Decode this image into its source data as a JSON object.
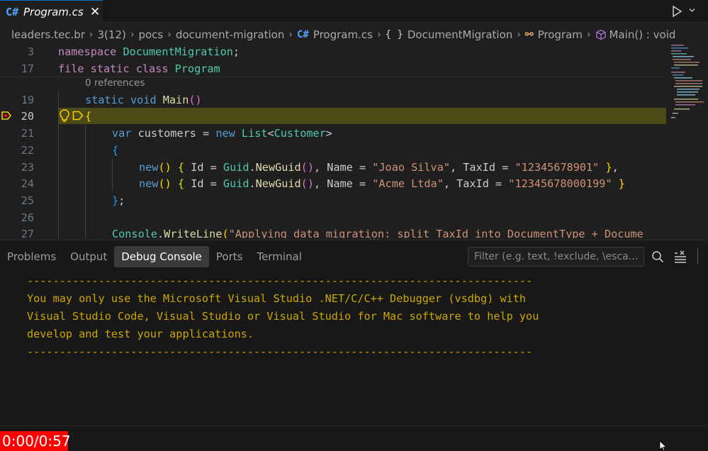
{
  "tab": {
    "icon": "csharp-file-icon",
    "glyph": "C#",
    "title": "Program.cs",
    "close": "✕"
  },
  "breadcrumb": {
    "items": [
      {
        "label": "leaders.tec.br"
      },
      {
        "label": "3(12)"
      },
      {
        "label": "pocs"
      },
      {
        "label": "document-migration"
      },
      {
        "label": "Program.cs",
        "icon": "csharp-file-icon",
        "glyph": "C#"
      },
      {
        "label": "DocumentMigration",
        "icon": "namespace-braces-icon",
        "glyph": "{ }"
      },
      {
        "label": "Program",
        "icon": "class-icon",
        "glyph": "⚯"
      },
      {
        "label": "Main() : void",
        "icon": "method-cube-icon"
      }
    ],
    "separator": "›"
  },
  "editor": {
    "codelens": "0 references",
    "current_line": "20",
    "line_numbers": [
      "3",
      "17",
      "19",
      "20",
      "21",
      "22",
      "23",
      "24",
      "25",
      "26",
      "27"
    ],
    "lines": {
      "l3": {
        "kw": "namespace",
        "ns": "DocumentMigration",
        "end": ";"
      },
      "l17": {
        "kw1": "file",
        "kw2": "static",
        "kw3": "class",
        "ty": "Program"
      },
      "l19": {
        "kw1": "static",
        "kw2": "void",
        "fn": "Main",
        "p1": "(",
        "p2": ")"
      },
      "l20": {
        "brace": "{"
      },
      "l21": {
        "kw": "var",
        "id": " customers = ",
        "kwnew": "new",
        "ty": "List",
        "lt": "<",
        "ty2": "Customer",
        "gt": ">"
      },
      "l22": {
        "brace": "{"
      },
      "l23": {
        "new": "new",
        "p": "()",
        "ob": "{",
        "a": " Id = ",
        "guid": "Guid",
        "dot": ".",
        "fn": "NewGuid",
        "p2": "()",
        "b": ", Name = ",
        "s1": "\"Joao Silva\"",
        "c": ", TaxId = ",
        "s2": "\"12345678901\"",
        "cb": "}",
        "end": ","
      },
      "l24": {
        "new": "new",
        "p": "()",
        "ob": "{",
        "a": " Id = ",
        "guid": "Guid",
        "dot": ".",
        "fn": "NewGuid",
        "p2": "()",
        "b": ", Name = ",
        "s1": "\"Acme Ltda\"",
        "c": ", TaxId = ",
        "s2": "\"12345678000199\"",
        "cb": "}"
      },
      "l25": {
        "brace": "}",
        "end": ";"
      },
      "l27": {
        "cls": "Console",
        "dot": ".",
        "fn": "WriteLine",
        "p": "(",
        "s": "\"Applying data migration: split TaxId into DocumentType + Docume"
      }
    }
  },
  "panel": {
    "tabs": [
      "Problems",
      "Output",
      "Debug Console",
      "Ports",
      "Terminal"
    ],
    "active_tab": "Debug Console",
    "filter_placeholder": "Filter (e.g. text, !exclude, \\esca...",
    "console_lines": [
      "------------------------------------------------------------------------------",
      "You may only use the Microsoft Visual Studio .NET/C/C++ Debugger (vsdbg) with",
      "Visual Studio Code, Visual Studio or Visual Studio for Mac software to help you",
      "develop and test your applications.",
      "------------------------------------------------------------------------------"
    ],
    "console_color": "#cca700"
  },
  "player": {
    "timer": "0:00/0:57"
  }
}
